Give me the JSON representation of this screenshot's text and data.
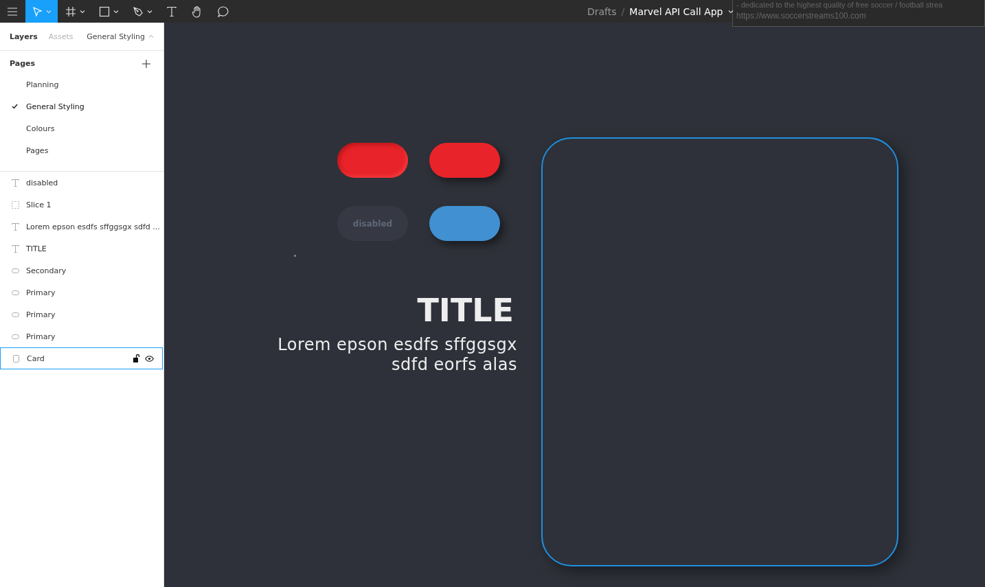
{
  "toolbar": {
    "tools": [
      {
        "kind": "move",
        "selected": true,
        "menu": true
      },
      {
        "kind": "frame",
        "selected": false,
        "menu": true
      },
      {
        "kind": "rect",
        "selected": false,
        "menu": true
      },
      {
        "kind": "pen",
        "selected": false,
        "menu": true
      },
      {
        "kind": "text",
        "selected": false,
        "menu": false
      },
      {
        "kind": "hand",
        "selected": false,
        "menu": false
      },
      {
        "kind": "comment",
        "selected": false,
        "menu": false
      }
    ],
    "breadcrumb": {
      "folder": "Drafts",
      "separator": "/",
      "file": "Marvel API Call App"
    }
  },
  "tooltip": {
    "title": "- dedicated to the highest quality of free soccer / football strea",
    "url": "https://www.soccerstreams100.com"
  },
  "sidebar": {
    "tabs": [
      {
        "label": "Layers",
        "selected": true
      },
      {
        "label": "Assets",
        "selected": false
      }
    ],
    "current_page": "General Styling",
    "pages_heading": "Pages",
    "pages": [
      {
        "label": "Planning",
        "selected": false
      },
      {
        "label": "General Styling",
        "selected": true
      },
      {
        "label": "Colours",
        "selected": false
      },
      {
        "label": "Pages",
        "selected": false
      }
    ],
    "layers": [
      {
        "kind": "text",
        "label": "disabled",
        "selected": false
      },
      {
        "kind": "slice",
        "label": "Slice 1",
        "selected": false
      },
      {
        "kind": "text",
        "label": "Lorem epson esdfs sffggsgx sdfd ...",
        "selected": false
      },
      {
        "kind": "text",
        "label": "TITLE",
        "selected": false
      },
      {
        "kind": "ellipse",
        "label": "Secondary",
        "selected": false
      },
      {
        "kind": "ellipse",
        "label": "Primary",
        "selected": false
      },
      {
        "kind": "ellipse",
        "label": "Primary",
        "selected": false
      },
      {
        "kind": "ellipse",
        "label": "Primary",
        "selected": false
      },
      {
        "kind": "rect",
        "label": "Card",
        "selected": true
      }
    ]
  },
  "canvas": {
    "buttons": [
      {
        "kind": "pressed",
        "color": "#e8232a"
      },
      {
        "kind": "raised",
        "color": "#e8232a"
      },
      {
        "kind": "disabled",
        "label": "disabled"
      },
      {
        "kind": "raised",
        "color": "#4190d2"
      }
    ],
    "title": "TITLE",
    "body": "Lorem epson esdfs sffggsgx sdfd eorfs alas"
  }
}
